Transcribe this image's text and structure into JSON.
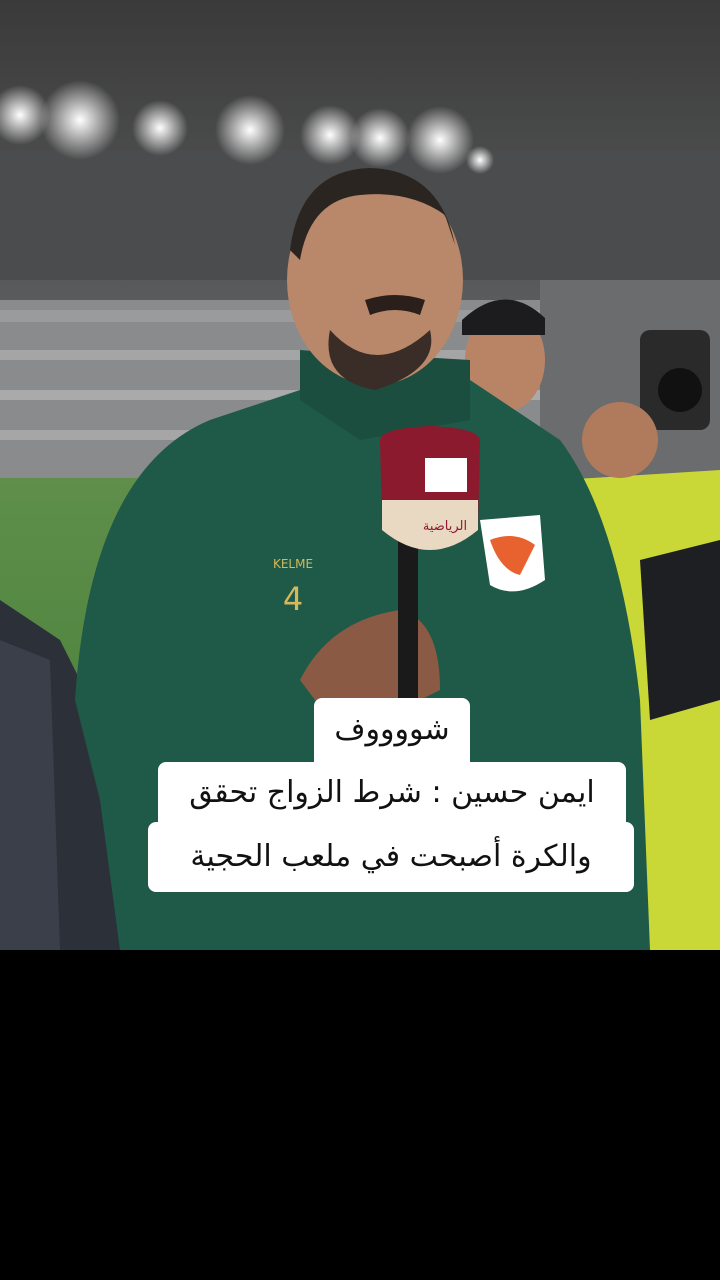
{
  "video": {
    "shirt_brand": "KELME",
    "shirt_number": "4",
    "mic_flag_text": "الرياضية"
  },
  "captions": {
    "line1": "شووووف",
    "line2": "ايمن حسين : شرط الزواج تحقق",
    "line3": "والكرة أصبحت في ملعب الحجية"
  },
  "colors": {
    "jacket": "#1f5a48",
    "mic_flag": "#8c1a2e",
    "pitch": "#3f7a35",
    "caption_bg": "#ffffff",
    "background": "#000000"
  }
}
